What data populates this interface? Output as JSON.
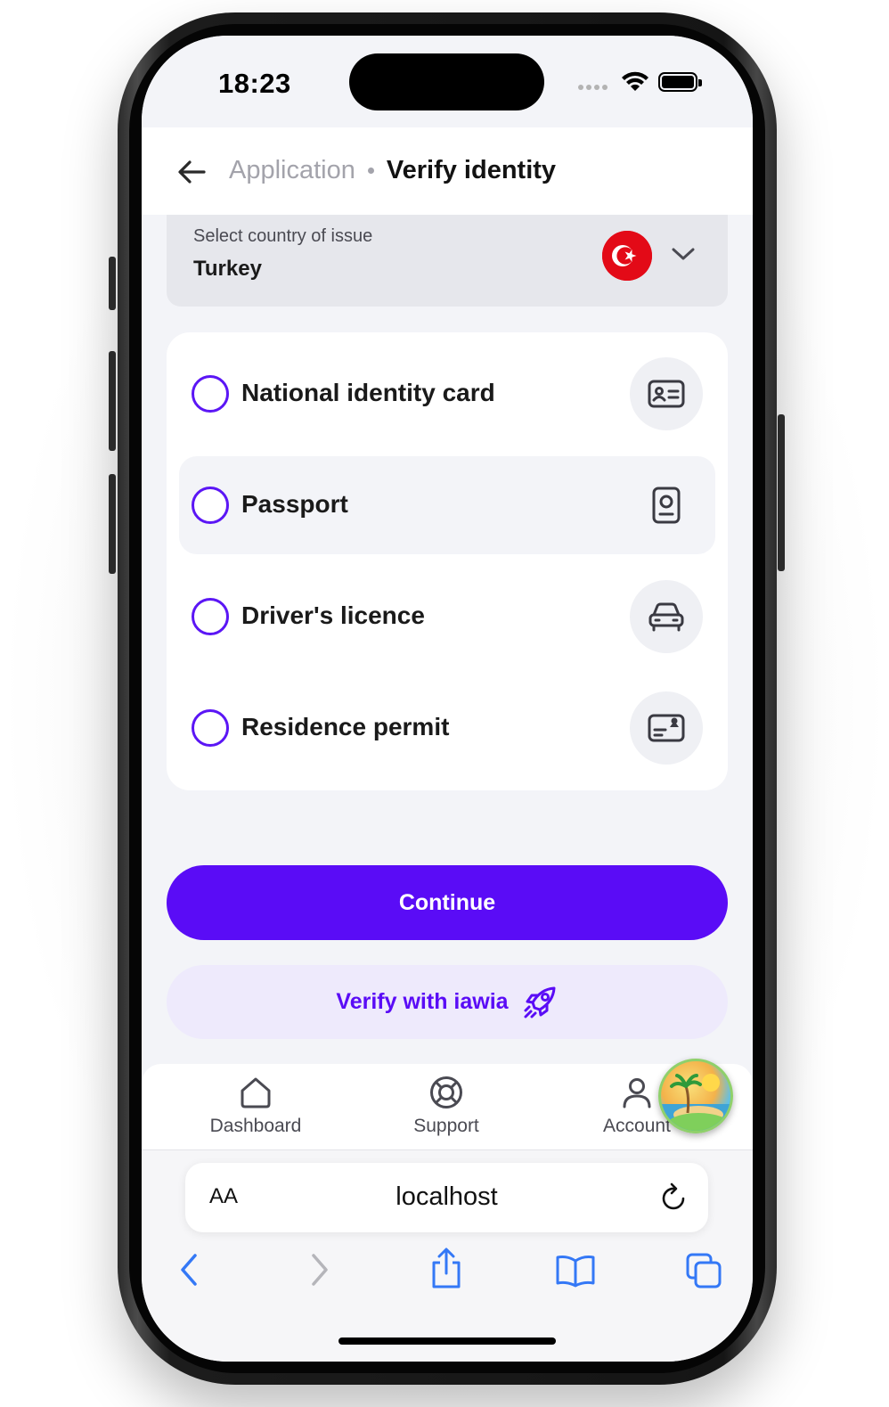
{
  "status_bar": {
    "time": "18:23"
  },
  "header": {
    "parent": "Application",
    "title": "Verify identity"
  },
  "country": {
    "label": "Select country of issue",
    "value": "Turkey",
    "flag_colors": {
      "red": "#e30a17",
      "white": "#ffffff"
    }
  },
  "documents": [
    {
      "label": "National identity card",
      "icon": "id-card-icon",
      "selected": false
    },
    {
      "label": "Passport",
      "icon": "passport-icon",
      "selected": false
    },
    {
      "label": "Driver's licence",
      "icon": "car-icon",
      "selected": false
    },
    {
      "label": "Residence permit",
      "icon": "residence-card-icon",
      "selected": false
    }
  ],
  "actions": {
    "continue": "Continue",
    "verify_iawia": "Verify with iawia"
  },
  "tabs": [
    {
      "label": "Dashboard",
      "icon": "home-icon"
    },
    {
      "label": "Support",
      "icon": "lifebuoy-icon"
    },
    {
      "label": "Account",
      "icon": "user-icon"
    }
  ],
  "browser": {
    "text_size_label": "AA",
    "host": "localhost"
  },
  "colors": {
    "accent": "#5a0cf6",
    "accent_soft": "#eeeafc",
    "background": "#f3f4f8",
    "safari_blue": "#3478f6"
  }
}
